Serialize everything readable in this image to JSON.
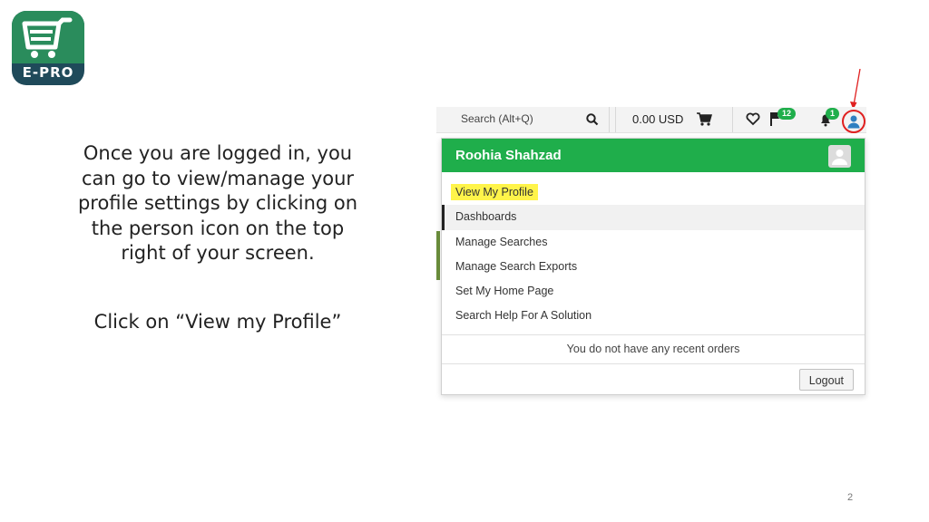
{
  "logo": {
    "text": "E-PRO",
    "icon": "shopping-cart-logo"
  },
  "instructions": {
    "lines": [
      "Once you are logged in, you",
      "can go to view/manage your",
      "profile settings by clicking on",
      "the person icon on the top",
      "right of your screen."
    ],
    "click_note": "Click on “View my Profile”"
  },
  "toolbar": {
    "search_placeholder": "Search (Alt+Q)",
    "search_icon": "search-icon",
    "price": "0.00 USD",
    "cart_icon": "cart-icon",
    "favorites_icon": "heart-icon",
    "flag_badge": "12",
    "bell_badge": "1",
    "user_icon": "user-icon"
  },
  "dropdown": {
    "user_name": "Roohia Shahzad",
    "menu": [
      "View My Profile",
      "Dashboards",
      "Manage Searches",
      "Manage Search Exports",
      "Set My Home Page",
      "Search Help For A Solution"
    ],
    "recent_orders": "You do not have any recent orders",
    "logout": "Logout"
  },
  "colors": {
    "accent_green": "#1fae4b",
    "highlight": "#fff44a",
    "annotation_red": "#e02020"
  },
  "page_number": "2"
}
